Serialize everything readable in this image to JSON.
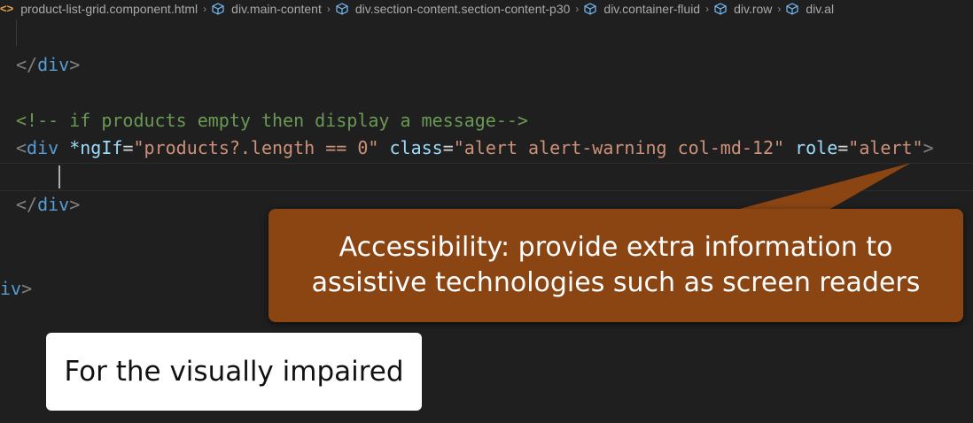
{
  "breadcrumb": {
    "items": [
      "product-list-grid.component.html",
      "div.main-content",
      "div.section-content.section-content-p30",
      "div.container-fluid",
      "div.row",
      "div.al"
    ]
  },
  "code": {
    "line_close_div_1": {
      "open": "</",
      "tag": "div",
      "close": ">"
    },
    "comment_line": "<!-- if products empty then display a message-->",
    "ngif_line": {
      "open": "<",
      "tag": "div",
      "directive": "*ngIf",
      "eq": "=",
      "directive_value": "\"products?.length == 0\"",
      "class_attr": "class",
      "class_value": "\"alert alert-warning col-md-12\"",
      "role_attr": "role",
      "role_value": "\"alert\"",
      "close": ">"
    },
    "line_close_div_2": {
      "open": "</",
      "tag": "div",
      "close": ">"
    },
    "line_close_div_3": {
      "tag": "iv",
      "close": ">"
    }
  },
  "callout": {
    "line1": "Accessibility: provide extra information to",
    "line2": "assistive technologies such as screen readers",
    "color": "#8b4513"
  },
  "note": {
    "text": "For the visually impaired"
  }
}
